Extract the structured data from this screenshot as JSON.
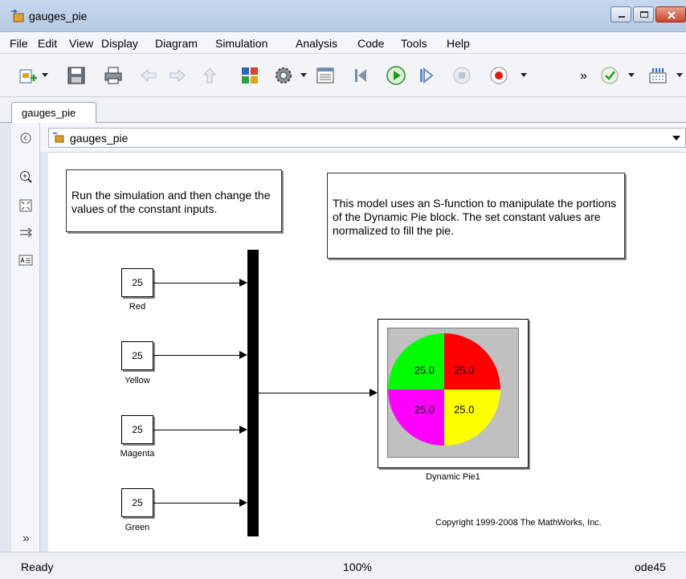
{
  "window": {
    "title": "gauges_pie"
  },
  "menu": [
    "File",
    "Edit",
    "View",
    "Display",
    "Diagram",
    "Simulation",
    "Analysis",
    "Code",
    "Tools",
    "Help"
  ],
  "toolbar": {
    "icons": [
      "new-model-icon",
      "save-icon",
      "print-icon",
      "back-icon",
      "forward-icon",
      "up-icon",
      "library-browser-icon",
      "model-config-icon",
      "model-explorer-icon",
      "step-back-icon",
      "run-icon",
      "step-forward-icon",
      "stop-icon",
      "record-icon",
      "overflow-icon",
      "check-icon",
      "build-icon"
    ],
    "overflow_label": "»"
  },
  "tab": {
    "label": "gauges_pie"
  },
  "address": {
    "path": "gauges_pie"
  },
  "notes": {
    "left": "Run the simulation and then change the values of the constant inputs.",
    "right": "This model uses an S-function to manipulate the portions of the Dynamic Pie block. The set constant values are normalized to fill the pie."
  },
  "constants": [
    {
      "value": "25",
      "label": "Red"
    },
    {
      "value": "25",
      "label": "Yellow"
    },
    {
      "value": "25",
      "label": "Magenta"
    },
    {
      "value": "25",
      "label": "Green"
    }
  ],
  "pie": {
    "label": "Dynamic Pie1",
    "slices": [
      {
        "name": "green-slice",
        "value": "25.0",
        "color": "#00ff00"
      },
      {
        "name": "red-slice",
        "value": "25.0",
        "color": "#ff0000"
      },
      {
        "name": "yellow-slice",
        "value": "25.0",
        "color": "#ffff00"
      },
      {
        "name": "magenta-slice",
        "value": "25.0",
        "color": "#ff00ff"
      }
    ]
  },
  "copyright": "Copyright 1999-2008 The MathWorks, Inc.",
  "expander": "»",
  "status": {
    "left": "Ready",
    "zoom": "100%",
    "solver": "ode45"
  }
}
